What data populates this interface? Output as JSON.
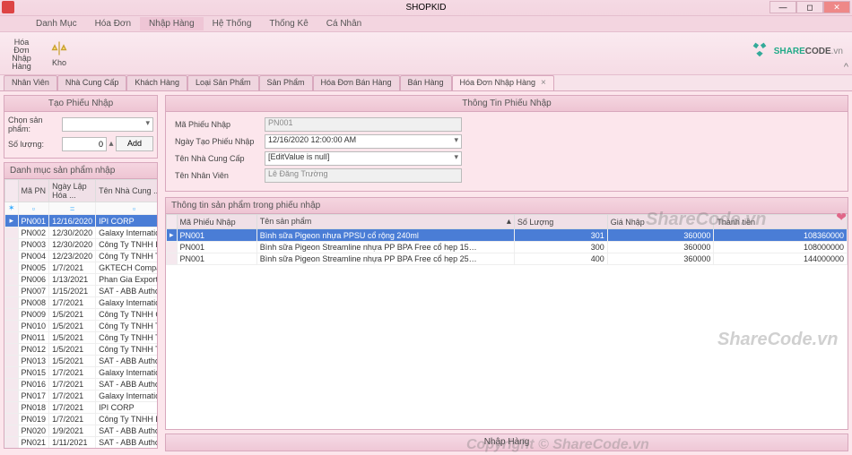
{
  "app": {
    "title": "SHOPKID"
  },
  "menu": [
    "Danh Mục",
    "Hóa Đơn",
    "Nhập Hàng",
    "Hệ Thống",
    "Thống Kê",
    "Cá Nhân"
  ],
  "ribbon": {
    "btn1": "Hóa Đơn\nNhập Hàng",
    "btn2": "Kho",
    "logo1": "SHARE",
    "logo2": "CODE",
    "logo3": ".vn"
  },
  "tabs": [
    "Nhân Viên",
    "Nhà Cung Cấp",
    "Khách Hàng",
    "Loại Sản Phẩm",
    "Sản Phẩm",
    "Hóa Đơn Bán Hàng",
    "Bán Hàng",
    "Hóa Đơn Nhập Hàng"
  ],
  "activeTab": 7,
  "left": {
    "hd1": "Tạo Phiếu Nhập",
    "l1": "Chọn sản phẩm:",
    "l2": "Số lượng:",
    "qty": "0",
    "add": "Add",
    "hd2": "Danh mục sản phẩm nhập",
    "cols": [
      "Mã PN",
      "Ngày Lập Hóa ...",
      "Tên Nhà Cung ..."
    ],
    "rows": [
      [
        "PN001",
        "12/16/2020",
        "IPI CORP"
      ],
      [
        "PN002",
        "12/30/2020",
        "Galaxy Internatio…"
      ],
      [
        "PN003",
        "12/30/2020",
        "Công Ty TNHH B…"
      ],
      [
        "PN004",
        "12/23/2020",
        "Công Ty TNHH T…"
      ],
      [
        "PN005",
        "1/7/2021",
        "GKTECH Company"
      ],
      [
        "PN006",
        "1/13/2021",
        "Phan Gia Export …"
      ],
      [
        "PN007",
        "1/15/2021",
        "SAT - ABB Autho…"
      ],
      [
        "PN008",
        "1/7/2021",
        "Galaxy Internatio…"
      ],
      [
        "PN009",
        "1/5/2021",
        "Công Ty TNHH C…"
      ],
      [
        "PN010",
        "1/5/2021",
        "Công Ty TNHH T…"
      ],
      [
        "PN011",
        "1/5/2021",
        "Công Ty TNHH T…"
      ],
      [
        "PN012",
        "1/5/2021",
        "Công Ty TNHH T…"
      ],
      [
        "PN013",
        "1/5/2021",
        "SAT - ABB Autho…"
      ],
      [
        "PN015",
        "1/7/2021",
        "Galaxy Internatio…"
      ],
      [
        "PN016",
        "1/7/2021",
        "SAT - ABB Autho…"
      ],
      [
        "PN017",
        "1/7/2021",
        "Galaxy Internatio…"
      ],
      [
        "PN018",
        "1/7/2021",
        "IPI CORP"
      ],
      [
        "PN019",
        "1/7/2021",
        "Công Ty TNHH B…"
      ],
      [
        "PN020",
        "1/9/2021",
        "SAT - ABB Autho…"
      ],
      [
        "PN021",
        "1/11/2021",
        "SAT - ABB Autho…"
      ]
    ],
    "selRow": 0
  },
  "info": {
    "hd": "Thông Tin Phiếu Nhập",
    "f1l": "Mã Phiếu Nhập",
    "f1v": "PN001",
    "f2l": "Ngày Tạo Phiếu Nhập",
    "f2v": "12/16/2020 12:00:00 AM",
    "f3l": "Tên Nhà Cung Cấp",
    "f3v": "[EditValue is null]",
    "f4l": "Tên Nhân Viên",
    "f4v": "Lê Đăng Trường"
  },
  "detail": {
    "hd": "Thông tin sản phẩm trong phiếu nhập",
    "cols": [
      "Mã Phiếu Nhập",
      "Tên sản phẩm",
      "Số Lượng",
      "Giá Nhập",
      "Thành tiền"
    ],
    "rows": [
      [
        "PN001",
        "Bình sữa Pigeon nhựa PPSU cổ rộng 240ml",
        "301",
        "360000",
        "108360000"
      ],
      [
        "PN001",
        "Bình sữa Pigeon Streamline nhựa PP BPA Free cổ hẹp 15…",
        "300",
        "360000",
        "108000000"
      ],
      [
        "PN001",
        "Bình sữa Pigeon Streamline nhựa PP BPA Free cổ hẹp 25…",
        "400",
        "360000",
        "144000000"
      ]
    ],
    "selRow": 0
  },
  "bottom": "Nhập Hàng",
  "wm": {
    "a": "ShareCode.vn",
    "b": "ShareCode.vn",
    "c": "Copyright © ShareCode.vn"
  }
}
